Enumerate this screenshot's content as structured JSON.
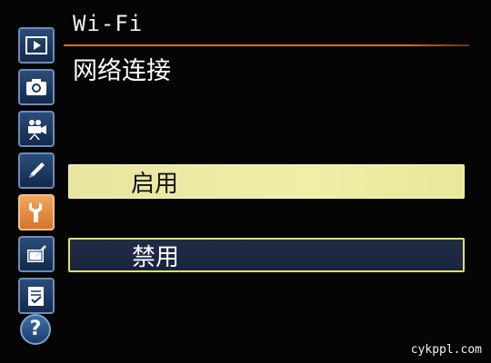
{
  "header": {
    "title": "Wi-Fi",
    "accent_color": "#d36b2a"
  },
  "page": {
    "title": "网络连接"
  },
  "options": [
    {
      "label": "启用",
      "state": "selected"
    },
    {
      "label": "禁用",
      "state": "normal"
    }
  ],
  "sidebar": {
    "items": [
      {
        "icon": "playback-icon"
      },
      {
        "icon": "camera-icon"
      },
      {
        "icon": "movie-camera-icon"
      },
      {
        "icon": "pencil-icon"
      },
      {
        "icon": "wrench-icon",
        "active": true
      },
      {
        "icon": "retouch-icon"
      },
      {
        "icon": "my-menu-icon"
      },
      {
        "icon": "help-icon",
        "glyph": "?"
      }
    ]
  },
  "watermark": "cykppl.com"
}
